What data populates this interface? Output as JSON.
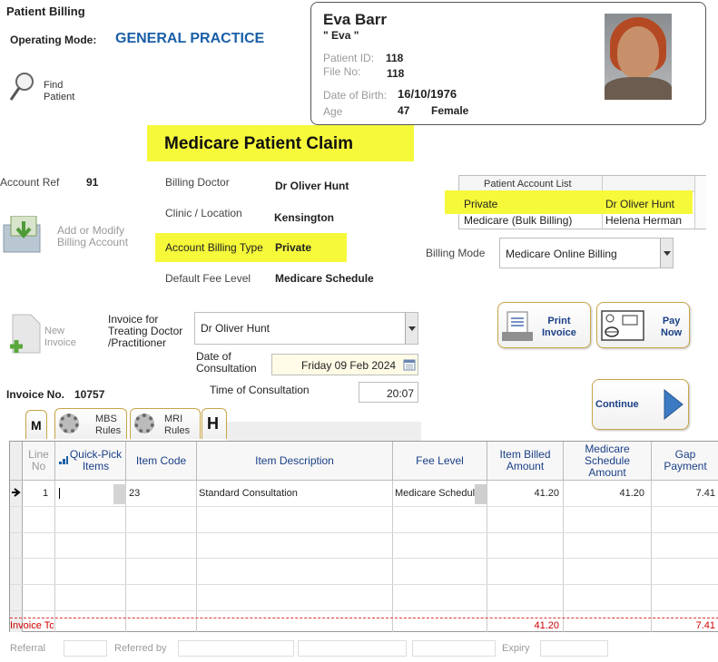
{
  "header": {
    "title": "Patient Billing",
    "mode_label": "Operating Mode:",
    "mode_value": "GENERAL PRACTICE",
    "find_patient": "Find\nPatient"
  },
  "patient": {
    "name": "Eva Barr",
    "nickname": "\" Eva \"",
    "id_label": "Patient ID:",
    "id": "118",
    "file_label": "File No:",
    "file": "118",
    "dob_label": "Date of Birth:",
    "dob": "16/10/1976",
    "age_label": "Age",
    "age": "47",
    "sex": "Female"
  },
  "claim_title": "Medicare Patient Claim",
  "account": {
    "ref_label": "Account Ref",
    "ref": "91",
    "add_modify": "Add or Modify\nBilling Account",
    "billing_doctor_label": "Billing Doctor",
    "billing_doctor": "Dr Oliver Hunt",
    "clinic_label": "Clinic / Location",
    "clinic": "Kensington",
    "type_label": "Account Billing Type",
    "type": "Private",
    "fee_label": "Default Fee Level",
    "fee": "Medicare Schedule"
  },
  "account_list": {
    "header": "Patient Account List",
    "rows": [
      {
        "type": "Private",
        "doctor": "Dr Oliver Hunt"
      },
      {
        "type": "Medicare (Bulk Billing)",
        "doctor": "Helena Herman"
      }
    ]
  },
  "billing_mode": {
    "label": "Billing Mode",
    "value": "Medicare Online Billing"
  },
  "invoice": {
    "new": "New\nInvoice",
    "treating_label": "Invoice for\nTreating Doctor\n/Practitioner",
    "treating": "Dr Oliver Hunt",
    "date_label": "Date of\nConsultation",
    "date": "Friday 09 Feb 2024",
    "time_label": "Time of Consultation",
    "time": "20:07",
    "no_label": "Invoice No.",
    "no": "10757"
  },
  "buttons": {
    "print": "Print\nInvoice",
    "pay": "Pay\nNow",
    "continue": "Continue"
  },
  "tabs": {
    "m": "M",
    "mbs": "MBS\nRules",
    "mri": "MRI\nRules",
    "h": "H"
  },
  "grid": {
    "headers": {
      "line": "Line\nNo",
      "quick": "Quick-Pick\nItems",
      "code": "Item Code",
      "desc": "Item Description",
      "fee": "Fee Level",
      "billed": "Item Billed\nAmount",
      "schedule": "Medicare\nSchedule\nAmount",
      "gap": "Gap\nPayment"
    },
    "row1": {
      "line": "1",
      "code": "23",
      "desc": "Standard Consultation",
      "fee": "Medicare Schedule",
      "billed": "41.20",
      "schedule": "41.20",
      "gap": "7.41"
    },
    "totals": {
      "label": "Invoice To",
      "billed": "41.20",
      "gap": "7.41"
    }
  },
  "footer": {
    "referral": "Referral",
    "referred_by": "Referred by",
    "expiry": "Expiry"
  },
  "colors": {
    "highlight": "#f6f93a",
    "accent_blue": "#1a5fa8",
    "totals_red": "#cc0000"
  }
}
